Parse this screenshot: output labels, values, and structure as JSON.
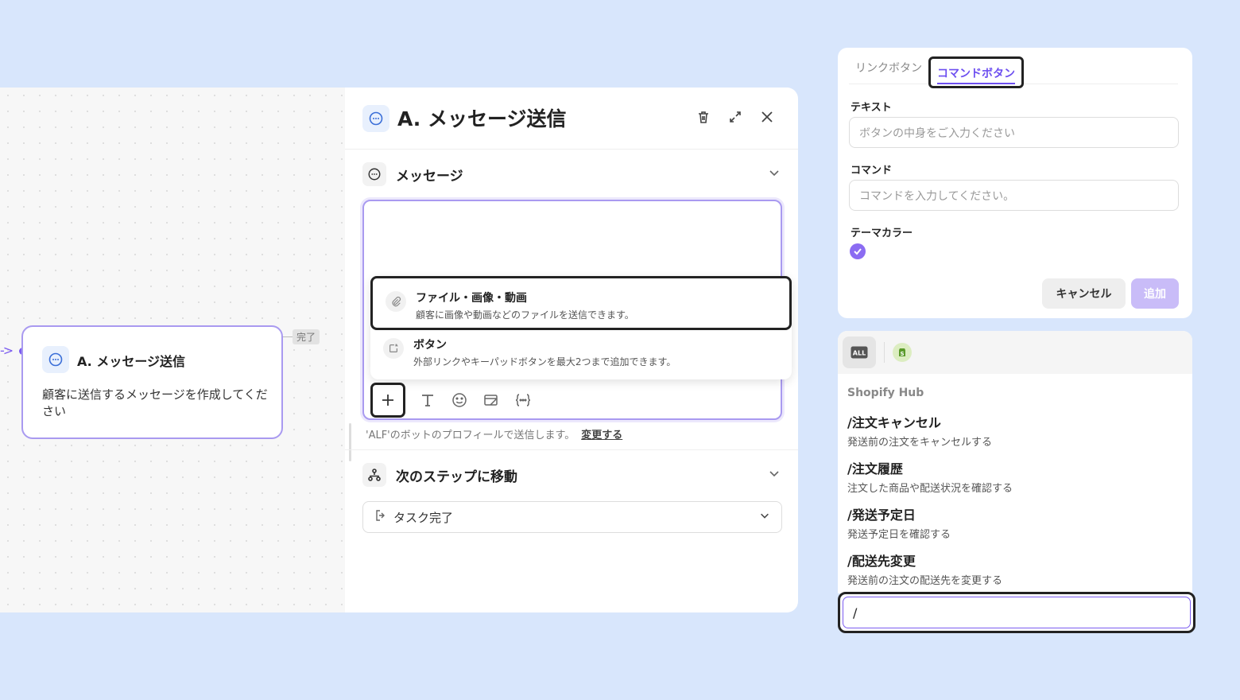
{
  "flow": {
    "node": {
      "title": "A. メッセージ送信",
      "description": "顧客に送信するメッセージを作成してください",
      "status": "完了"
    }
  },
  "editor": {
    "title": "A.  メッセージ送信",
    "message_section": {
      "title": "メッセージ"
    },
    "attach_menu": [
      {
        "title": "ファイル・画像・動画",
        "description": "顧客に画像や動画などのファイルを送信できます。",
        "icon": "paperclip-icon"
      },
      {
        "title": "ボタン",
        "description": "外部リンクやキーパッドボタンを最大2つまで追加できます。",
        "icon": "button-icon"
      }
    ],
    "bot_note": "'ALF'のボットのプロフィールで送信します。",
    "bot_note_link": "変更する",
    "next_step_section": {
      "title": "次のステップに移動"
    },
    "next_step_select": {
      "value": "タスク完了"
    }
  },
  "button_form": {
    "tabs": [
      {
        "label": "リンクボタン"
      },
      {
        "label": "コマンドボタン"
      }
    ],
    "text_label": "テキスト",
    "text_placeholder": "ボタンの中身をご入力ください",
    "command_label": "コマンド",
    "command_placeholder": "コマンドを入力してください。",
    "theme_label": "テーマカラー",
    "theme_color": "#8b6cf2",
    "cancel_label": "キャンセル",
    "add_label": "追加"
  },
  "command_picker": {
    "apps": [
      {
        "label": "ALL"
      },
      {
        "icon": "shopify-icon"
      }
    ],
    "group": "Shopify Hub",
    "commands": [
      {
        "name": "/注文キャンセル",
        "description": "発送前の注文をキャンセルする"
      },
      {
        "name": "/注文履歴",
        "description": "注文した商品や配送状況を確認する"
      },
      {
        "name": "/発送予定日",
        "description": "発送予定日を確認する"
      },
      {
        "name": "/配送先変更",
        "description": "発送前の注文の配送先を変更する"
      }
    ],
    "input_value": "/"
  },
  "colors": {
    "accent": "#6d4ff0",
    "background": "#d8e6fc"
  }
}
